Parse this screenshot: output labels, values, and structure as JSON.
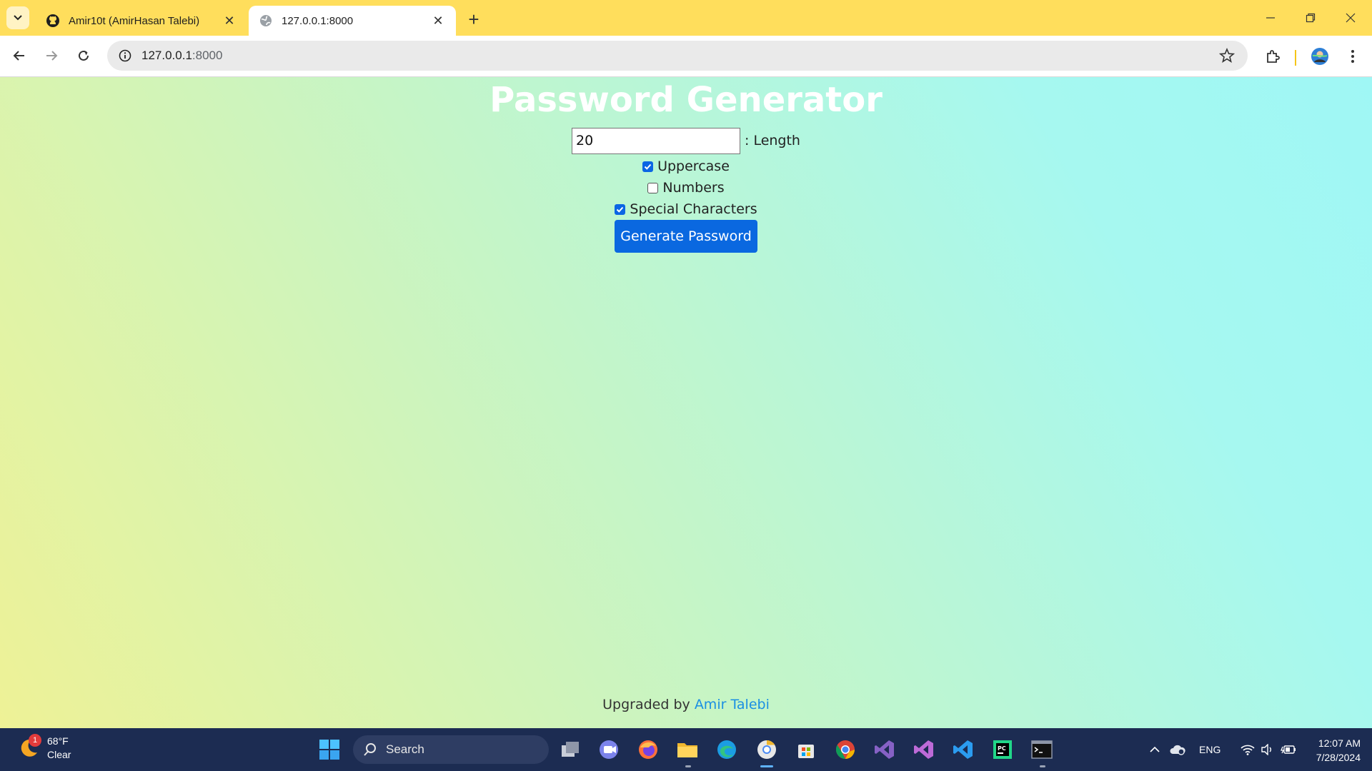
{
  "browser": {
    "tabs": [
      {
        "title": "Amir10t (AmirHasan Talebi)",
        "favicon": "github-icon",
        "active": false
      },
      {
        "title": "127.0.0.1:8000",
        "favicon": "globe-icon",
        "active": true
      }
    ],
    "address": {
      "host": "127.0.0.1",
      "port": ":8000"
    }
  },
  "page": {
    "title": "Password Generator",
    "length_value": "20",
    "length_label": ": Length",
    "options": [
      {
        "label": "Uppercase",
        "checked": true
      },
      {
        "label": "Numbers",
        "checked": false
      },
      {
        "label": "Special Characters",
        "checked": true
      }
    ],
    "generate_label": "Generate Password",
    "footer_prefix": "Upgraded by",
    "footer_link": "Amir Talebi"
  },
  "taskbar": {
    "weather_temp": "68°F",
    "weather_desc": "Clear",
    "weather_badge": "1",
    "search_label": "Search",
    "language": "ENG",
    "time": "12:07 AM",
    "date": "7/28/2024"
  },
  "colors": {
    "accent": "#0a68e0",
    "tab_strip": "#ffde5c",
    "taskbar": "#1c2c52"
  }
}
